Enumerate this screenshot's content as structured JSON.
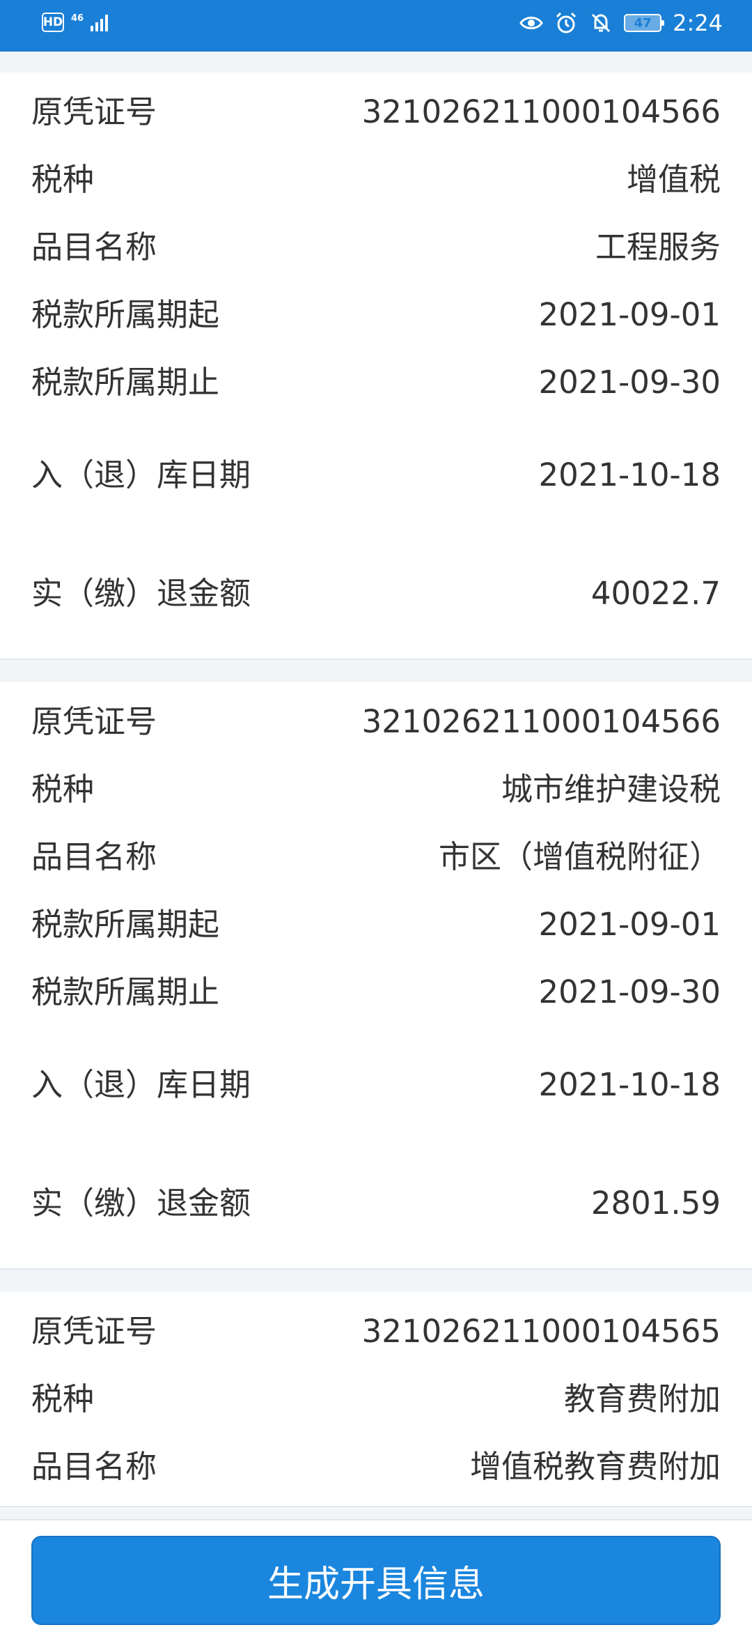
{
  "status_bar": {
    "hd": "HD",
    "network": "46",
    "battery": "47",
    "time": "2:24"
  },
  "records": [
    {
      "rows": [
        {
          "label": "原凭证号",
          "value": "321026211000104566"
        },
        {
          "label": "税种",
          "value": "增值税"
        },
        {
          "label": "品目名称",
          "value": "工程服务"
        },
        {
          "label": "税款所属期起",
          "value": "2021-09-01"
        },
        {
          "label": "税款所属期止",
          "value": "2021-09-30"
        },
        {
          "label": "入（退）库日期",
          "value": "2021-10-18"
        },
        {
          "label": "实（缴）退金额",
          "value": "40022.7"
        }
      ]
    },
    {
      "rows": [
        {
          "label": "原凭证号",
          "value": "321026211000104566"
        },
        {
          "label": "税种",
          "value": "城市维护建设税"
        },
        {
          "label": "品目名称",
          "value": "市区（增值税附征）"
        },
        {
          "label": "税款所属期起",
          "value": "2021-09-01"
        },
        {
          "label": "税款所属期止",
          "value": "2021-09-30"
        },
        {
          "label": "入（退）库日期",
          "value": "2021-10-18"
        },
        {
          "label": "实（缴）退金额",
          "value": "2801.59"
        }
      ]
    },
    {
      "rows": [
        {
          "label": "原凭证号",
          "value": "321026211000104565"
        },
        {
          "label": "税种",
          "value": "教育费附加"
        },
        {
          "label": "品目名称",
          "value": "增值税教育费附加"
        }
      ]
    }
  ],
  "footer": {
    "generate_label": "生成开具信息"
  },
  "colors": {
    "accent": "#1a86de",
    "status_bar": "#1a7fd6",
    "background": "#f2f5f8"
  }
}
